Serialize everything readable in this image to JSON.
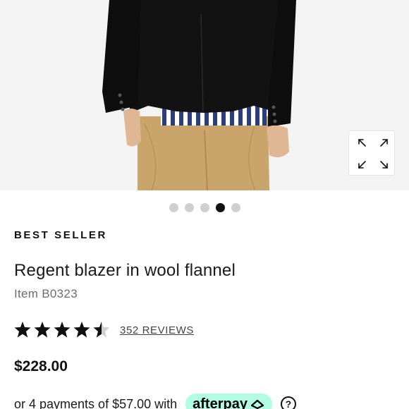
{
  "product": {
    "badge": "BEST SELLER",
    "title": "Regent blazer in wool flannel",
    "item_number": "Item B0323",
    "rating": 4.5,
    "reviews_label": "352 REVIEWS",
    "price": "$228.00"
  },
  "gallery": {
    "image_count": 5,
    "active_index": 3,
    "expand_icon": "expand-arrows-icon"
  },
  "payment": {
    "installment_text": "or 4 payments of $57.00 with",
    "provider": "afterpay",
    "provider_color": "#b2fce4",
    "help_symbol": "?"
  }
}
